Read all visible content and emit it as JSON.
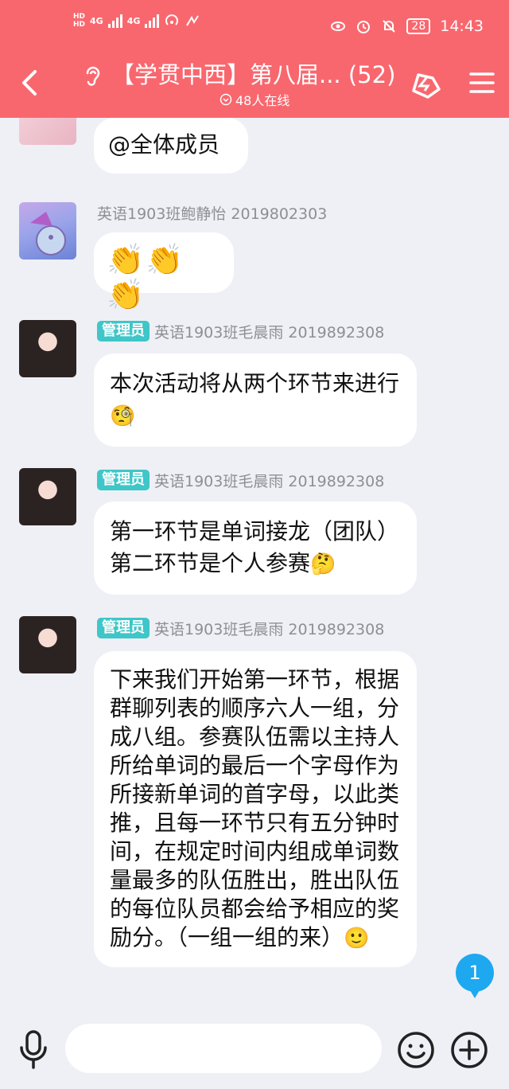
{
  "status_bar": {
    "hd1": "HD",
    "hd2": "HD",
    "net1": "4G",
    "net2": "4G",
    "battery": "28",
    "time": "14:43"
  },
  "header": {
    "title": "【学贯中西】第八届... (52)",
    "online": "48人在线"
  },
  "messages": [
    {
      "sender": "",
      "text": "@全体成员"
    },
    {
      "sender": "英语1903班鲍静怡 2019802303",
      "text": "👏👏👏"
    },
    {
      "badge": "管理员",
      "sender": "英语1903班毛晨雨 2019892308",
      "text": "本次活动将从两个环节来进行",
      "emoji": "🧐"
    },
    {
      "badge": "管理员",
      "sender": "英语1903班毛晨雨 2019892308",
      "text": "第一环节是单词接龙（团队）第二环节是个人参赛",
      "emoji": "🤔"
    },
    {
      "badge": "管理员",
      "sender": "英语1903班毛晨雨 2019892308",
      "text": "下来我们开始第一环节，根据群聊列表的顺序六人一组，分成八组。参赛队伍需以主持人所给单词的最后一个字母作为所接新单词的首字母，以此类推，且每一环节只有五分钟时间，在规定时间内组成单词数量最多的队伍胜出，胜出队伍的每位队员都会给予相应的奖励分。（一组一组的来）",
      "emoji": "🙂"
    }
  ],
  "unread_count": "1",
  "input": {
    "placeholder": ""
  },
  "colors": {
    "header": "#f9676e",
    "badge": "#3fc6c8",
    "unread": "#1ea8f0"
  },
  "icons": [
    "back-arrow-icon",
    "ear-icon",
    "share-icon",
    "menu-icon",
    "mic-icon",
    "emoji-icon",
    "plus-icon"
  ]
}
